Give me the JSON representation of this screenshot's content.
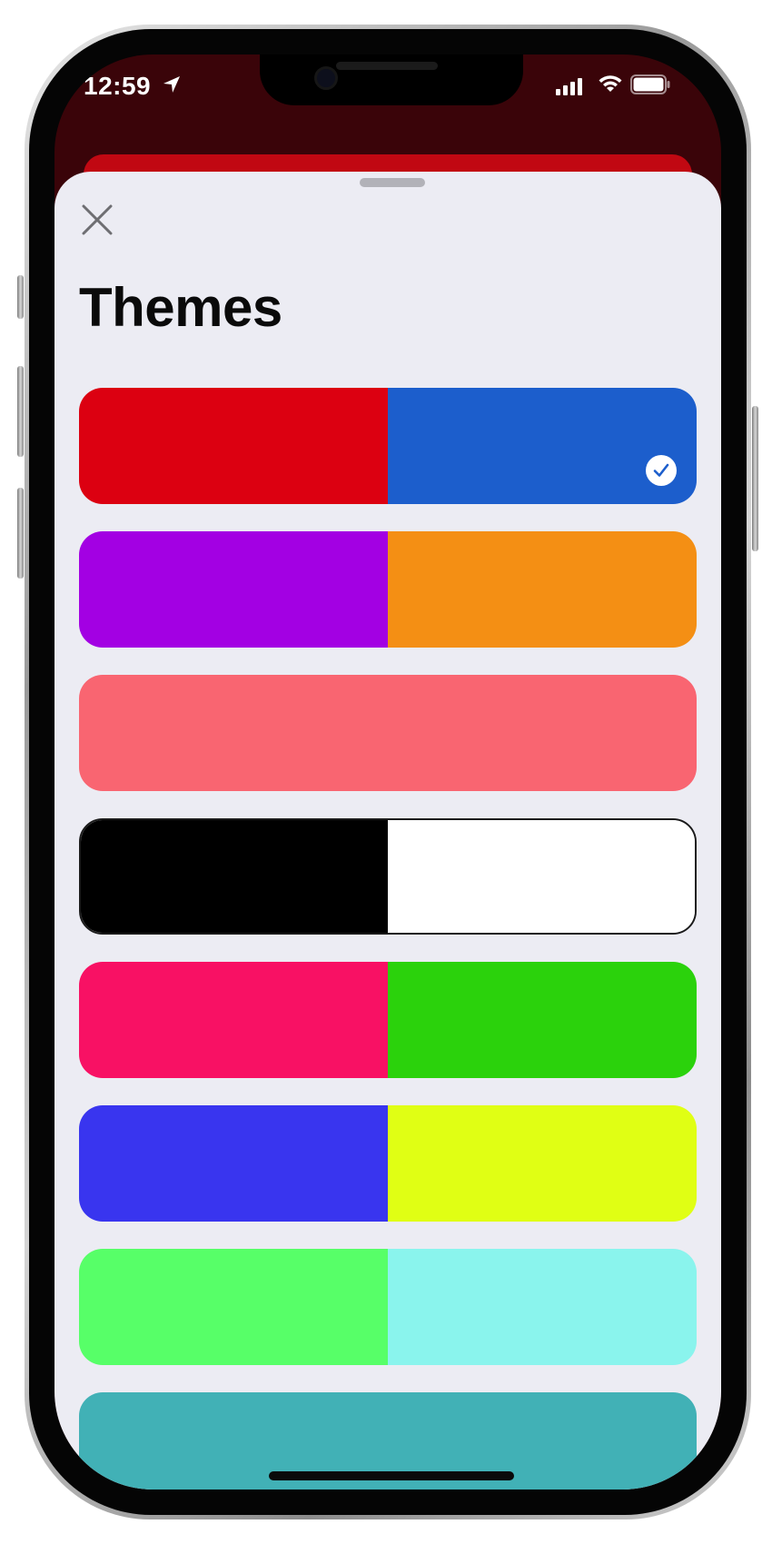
{
  "status_bar": {
    "time": "12:59",
    "icons": [
      "location-arrow-icon",
      "cellular-signal-icon",
      "wifi-icon",
      "battery-icon"
    ]
  },
  "sheet": {
    "close_icon": "close-icon",
    "title": "Themes"
  },
  "background_accent": "#c10812",
  "themes": [
    {
      "colors": [
        "#dc0011",
        "#1c5ecc"
      ],
      "selected": true
    },
    {
      "colors": [
        "#a300e3",
        "#f48f14"
      ],
      "selected": false
    },
    {
      "colors": [
        "#f96571",
        "#f96571"
      ],
      "selected": false
    },
    {
      "colors": [
        "#000000",
        "#ffffff"
      ],
      "selected": false
    },
    {
      "colors": [
        "#f81164",
        "#2bd20c"
      ],
      "selected": false
    },
    {
      "colors": [
        "#3935ef",
        "#e0ff14"
      ],
      "selected": false
    },
    {
      "colors": [
        "#57ff68",
        "#8af4ed"
      ],
      "selected": false
    },
    {
      "colors": [
        "#41b1b6",
        "#41b1b6"
      ],
      "selected": false
    }
  ]
}
